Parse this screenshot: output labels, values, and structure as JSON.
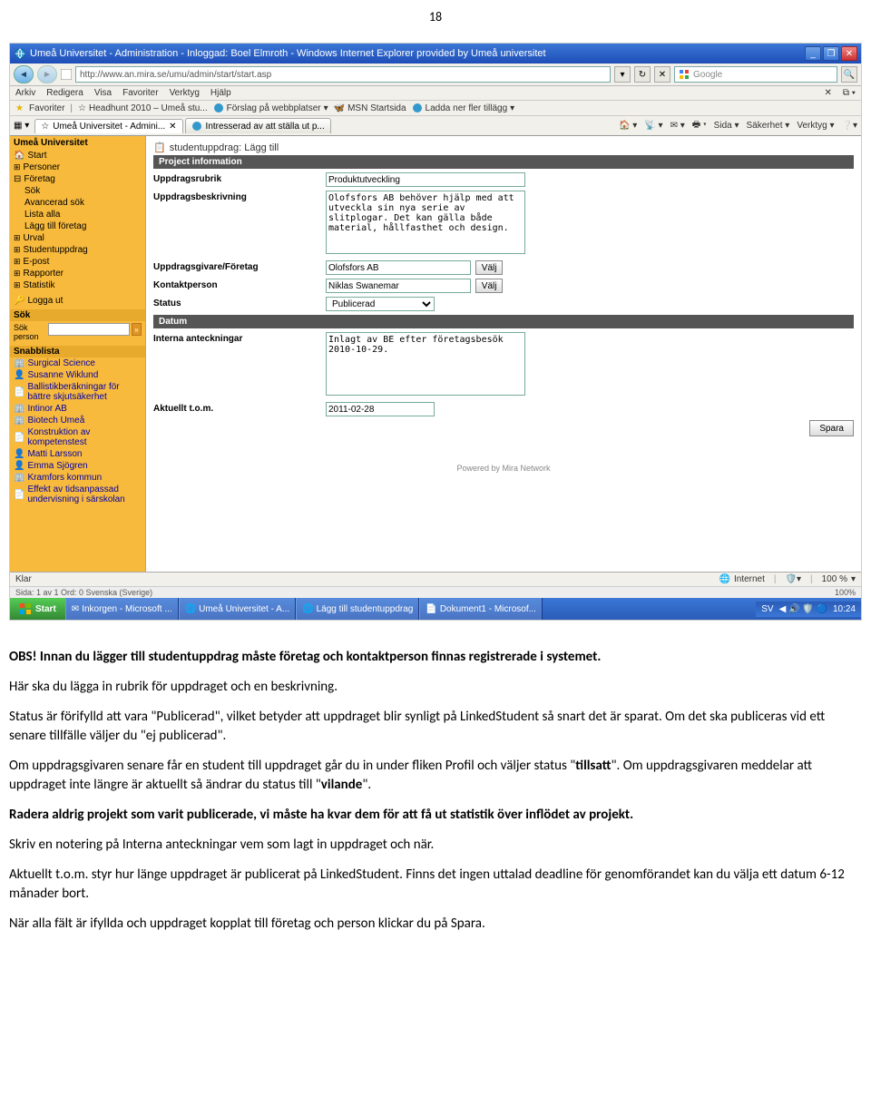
{
  "page_number": "18",
  "ie": {
    "title": "Umeå Universitet - Administration - Inloggad: Boel Elmroth - Windows Internet Explorer provided by Umeå universitet",
    "url": "http://www.an.mira.se/umu/admin/start/start.asp",
    "search_placeholder": "Google",
    "menus": [
      "Arkiv",
      "Redigera",
      "Visa",
      "Favoriter",
      "Verktyg",
      "Hjälp"
    ],
    "fav_label": "Favoriter",
    "fav_items": [
      "Headhunt 2010 – Umeå stu...",
      "Förslag på webbplatser",
      "MSN Startsida",
      "Ladda ner fler tillägg"
    ],
    "tab1": "Umeå Universitet - Admini...",
    "tab2": "Intresserad av att ställa ut p...",
    "tabtools": [
      "Sida",
      "Säkerhet",
      "Verktyg"
    ],
    "status_left": "Klar",
    "status_zone": "Internet",
    "status_zoom": "100 %"
  },
  "sidebar": {
    "brand": "Umeå Universitet",
    "items": [
      "Start",
      "Personer",
      "Företag"
    ],
    "foretag_sub": [
      "Sök",
      "Avancerad sök",
      "Lista alla",
      "Lägg till företag"
    ],
    "items2": [
      "Urval",
      "Studentuppdrag",
      "E-post",
      "Rapporter",
      "Statistik"
    ],
    "logout": "Logga ut",
    "sok_header": "Sök",
    "sok_label": "Sök person",
    "snabb_header": "Snabblista",
    "snabb": [
      "Surgical Science",
      "Susanne Wiklund",
      "Ballistikberäkningar för bättre skjutsäkerhet",
      "Intinor AB",
      "Biotech Umeå",
      "Konstruktion av kompetenstest",
      "Matti Larsson",
      "Emma Sjögren",
      "Kramfors kommun",
      "Effekt av tidsanpassad undervisning i särskolan"
    ]
  },
  "form": {
    "panel_title": "studentuppdrag: Lägg till",
    "sec1": "Project information",
    "lbl_rubrik": "Uppdragsrubrik",
    "val_rubrik": "Produktutveckling",
    "lbl_beskrivning": "Uppdragsbeskrivning",
    "val_beskrivning": "Olofsfors AB behöver hjälp med att utveckla sin nya serie av slitplogar. Det kan gälla både material, hållfasthet och design.",
    "lbl_foretag": "Uppdragsgivare/Företag",
    "val_foretag": "Olofsfors AB",
    "lbl_kontakt": "Kontaktperson",
    "val_kontakt": "Niklas Swanemar",
    "lbl_status": "Status",
    "val_status": "Publicerad",
    "btn_valj": "Välj",
    "sec2": "Datum",
    "lbl_interna": "Interna anteckningar",
    "val_interna": "Inlagt av BE efter företagsbesök 2010-10-29.",
    "lbl_aktuellt": "Aktuellt t.o.m.",
    "val_aktuellt": "2011-02-28",
    "btn_spara": "Spara",
    "powered": "Powered by Mira Network"
  },
  "extrabar": {
    "text": "Sida: 1 av 1   Ord: 0   Svenska (Sverige)",
    "zoom": "100%"
  },
  "taskbar": {
    "start": "Start",
    "items": [
      "Inkorgen - Microsoft ...",
      "Umeå Universitet - A...",
      "Lägg till studentuppdrag",
      "Dokument1 - Microsof..."
    ],
    "tray_lang": "SV",
    "tray_time": "10:24"
  },
  "doc": {
    "p1a": "OBS! Innan du lägger till studentuppdrag måste företag och kontaktperson finnas registrerade i systemet.",
    "p2": "Här ska du lägga in rubrik för uppdraget och en beskrivning.",
    "p3": "Status är förifylld att vara \"Publicerad\", vilket betyder att uppdraget blir synligt på LinkedStudent så snart det är sparat. Om det ska publiceras vid ett senare tillfälle väljer du \"ej publicerad\".",
    "p4a": "Om uppdragsgivaren senare får en student till uppdraget går du in under fliken Profil och väljer status \"",
    "p4b": "tillsatt",
    "p4c": "\". Om uppdragsgivaren meddelar att uppdraget inte längre är aktuellt så ändrar du status till \"",
    "p4d": "vilande",
    "p4e": "\".",
    "p5": "Radera aldrig projekt som varit publicerade, vi måste ha kvar dem för att få ut statistik över inflödet av projekt.",
    "p6": "Skriv en notering på Interna anteckningar vem som lagt in uppdraget och när.",
    "p7": "Aktuellt t.o.m. styr hur länge uppdraget är publicerat på LinkedStudent. Finns det ingen uttalad deadline för genomförandet kan du välja ett datum 6-12 månader bort.",
    "p8": "När alla fält är ifyllda och uppdraget kopplat till företag och person klickar du på Spara."
  }
}
